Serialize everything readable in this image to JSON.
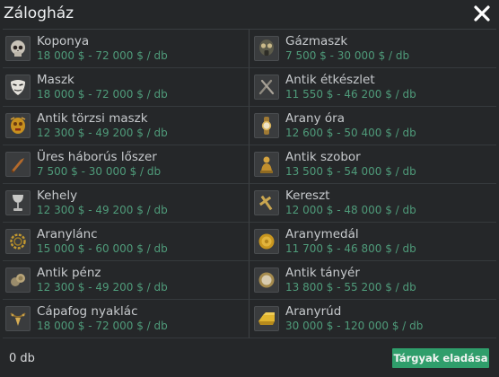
{
  "window": {
    "title": "Zálogház",
    "close_icon": "close-icon"
  },
  "items": [
    {
      "name": "Koponya",
      "price": "18 000 $ - 72 000 $ / db",
      "icon": "skull-icon"
    },
    {
      "name": "Gázmaszk",
      "price": "7 500 $ - 30 000 $ / db",
      "icon": "gas-mask-icon"
    },
    {
      "name": "Maszk",
      "price": "18 000 $ - 72 000 $ / db",
      "icon": "mask-icon"
    },
    {
      "name": "Antik étkészlet",
      "price": "11 550 $ - 46 200 $ / db",
      "icon": "cutlery-icon"
    },
    {
      "name": "Antik törzsi maszk",
      "price": "12 300 $ - 49 200 $ / db",
      "icon": "tribal-mask-icon"
    },
    {
      "name": "Arany óra",
      "price": "12 600 $ - 50 400 $ / db",
      "icon": "gold-watch-icon"
    },
    {
      "name": "Üres háborús lőszer",
      "price": "7 500 $ - 30 000 $ / db",
      "icon": "ammo-shell-icon"
    },
    {
      "name": "Antik szobor",
      "price": "13 500 $ - 54 000 $ / db",
      "icon": "statue-icon"
    },
    {
      "name": "Kehely",
      "price": "12 300 $ - 49 200 $ / db",
      "icon": "chalice-icon"
    },
    {
      "name": "Kereszt",
      "price": "12 000 $ - 48 000 $ / db",
      "icon": "cross-icon"
    },
    {
      "name": "Aranylánc",
      "price": "15 000 $ - 60 000 $ / db",
      "icon": "gold-chain-icon"
    },
    {
      "name": "Aranymedál",
      "price": "11 700 $ - 46 800 $ / db",
      "icon": "gold-medal-icon"
    },
    {
      "name": "Antik pénz",
      "price": "12 300 $ - 49 200 $ / db",
      "icon": "coins-icon"
    },
    {
      "name": "Antik tányér",
      "price": "13 800 $ - 55 200 $ / db",
      "icon": "plate-icon"
    },
    {
      "name": "Cápafog nyaklác",
      "price": "18 000 $ - 72 000 $ / db",
      "icon": "shark-tooth-necklace-icon"
    },
    {
      "name": "Aranyrúd",
      "price": "30 000 $ - 120 000 $ / db",
      "icon": "gold-bar-icon"
    }
  ],
  "footer": {
    "count": "0 db",
    "sell_label": "Tárgyak eladása"
  },
  "colors": {
    "background": "#252729",
    "price_text": "#4f9b7a",
    "sell_button": "#2f9e6b"
  }
}
